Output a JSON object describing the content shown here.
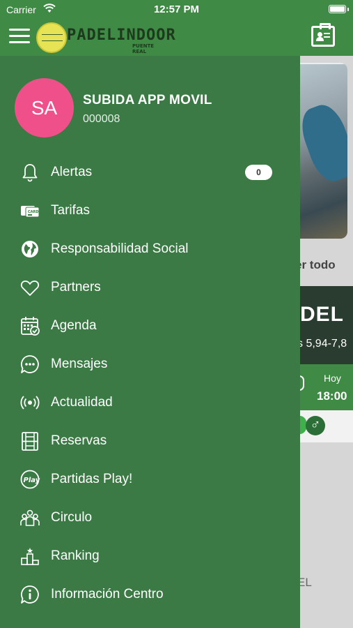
{
  "status": {
    "carrier": "Carrier",
    "time": "12:57 PM"
  },
  "header": {
    "logo_text": "PADELINDOOR",
    "logo_sub": "PUENTE REAL"
  },
  "user": {
    "initials": "SA",
    "name": "SUBIDA APP MOVIL",
    "code": "000008"
  },
  "menu": {
    "items": [
      {
        "label": "Alertas",
        "icon": "bell-icon",
        "badge": "0"
      },
      {
        "label": "Tarifas",
        "icon": "card-icon"
      },
      {
        "label": "Responsabilidad Social",
        "icon": "globe-icon"
      },
      {
        "label": "Partners",
        "icon": "heart-icon"
      },
      {
        "label": "Agenda",
        "icon": "calendar-icon"
      },
      {
        "label": "Mensajes",
        "icon": "chat-icon"
      },
      {
        "label": "Actualidad",
        "icon": "broadcast-icon"
      },
      {
        "label": "Reservas",
        "icon": "court-icon"
      },
      {
        "label": "Partidas Play!",
        "icon": "play-icon"
      },
      {
        "label": "Circulo",
        "icon": "group-icon"
      },
      {
        "label": "Ranking",
        "icon": "podium-icon"
      },
      {
        "label": "Información Centro",
        "icon": "info-icon"
      }
    ]
  },
  "background": {
    "ver_todo": "er todo",
    "card_title": "DEL",
    "card_price": "s 5,94-7,8",
    "card_today": "Hoy",
    "card_hour": "18:00",
    "gender_symbol": "♂",
    "lower_label": "EL"
  },
  "colors": {
    "green": "#3b7a45",
    "header_green": "#3f8a45",
    "avatar": "#f0508a"
  }
}
